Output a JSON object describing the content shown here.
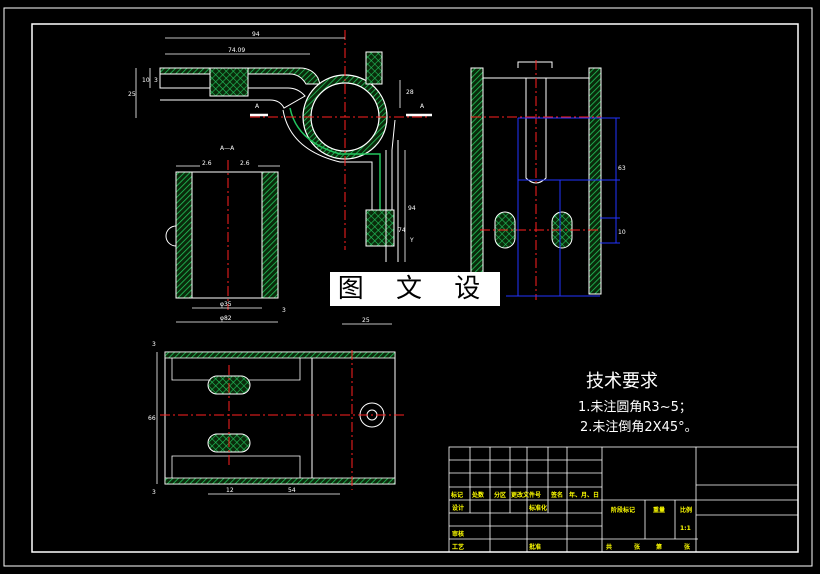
{
  "watermark": "图 文 设 计",
  "tech_requirements": {
    "title": "技术要求",
    "items": [
      "1.未注圆角R3~5；",
      "2.未注倒角2X45°。"
    ]
  },
  "section_marks": {
    "a": "A",
    "a2": "A",
    "aa": "A—A",
    "y": "Y"
  },
  "dims": {
    "d94_top": "94",
    "d7409": "74.09",
    "d25": "25",
    "d10": "10",
    "d3_top": "3",
    "d28": "28",
    "d94_side": "94",
    "d74": "74",
    "d25_bottom": "25",
    "d26_left": "2.6",
    "d26_right": "2.6",
    "dphi35": "φ35",
    "dphi82": "φ82",
    "d3_mid": "3",
    "d3_plan_top": "3",
    "d66": "66",
    "d3_plan_bot": "3",
    "d12": "12",
    "d54": "54",
    "d63": "63",
    "d10_right": "10"
  },
  "title_block": {
    "row_labels": [
      "标记",
      "处数",
      "分区",
      "更改文件号",
      "签名",
      "年、月、日"
    ],
    "design": "设计",
    "standardize": "标准化",
    "stage_mark": "阶段标记",
    "weight": "重量",
    "scale": "比例",
    "scale_value": "1:1",
    "review": "审核",
    "process": "工艺",
    "approve": "批准",
    "sheets_total": "共",
    "sheets_total_unit": "张",
    "sheet_no": "第",
    "sheet_no_unit": "张"
  },
  "colors": {
    "outline": "#ffffff",
    "hatch": "#22c55e",
    "centerline": "#ff2020",
    "hidden": "#2233ff",
    "dimension": "#ffffff",
    "title_text": "#ffff00"
  }
}
